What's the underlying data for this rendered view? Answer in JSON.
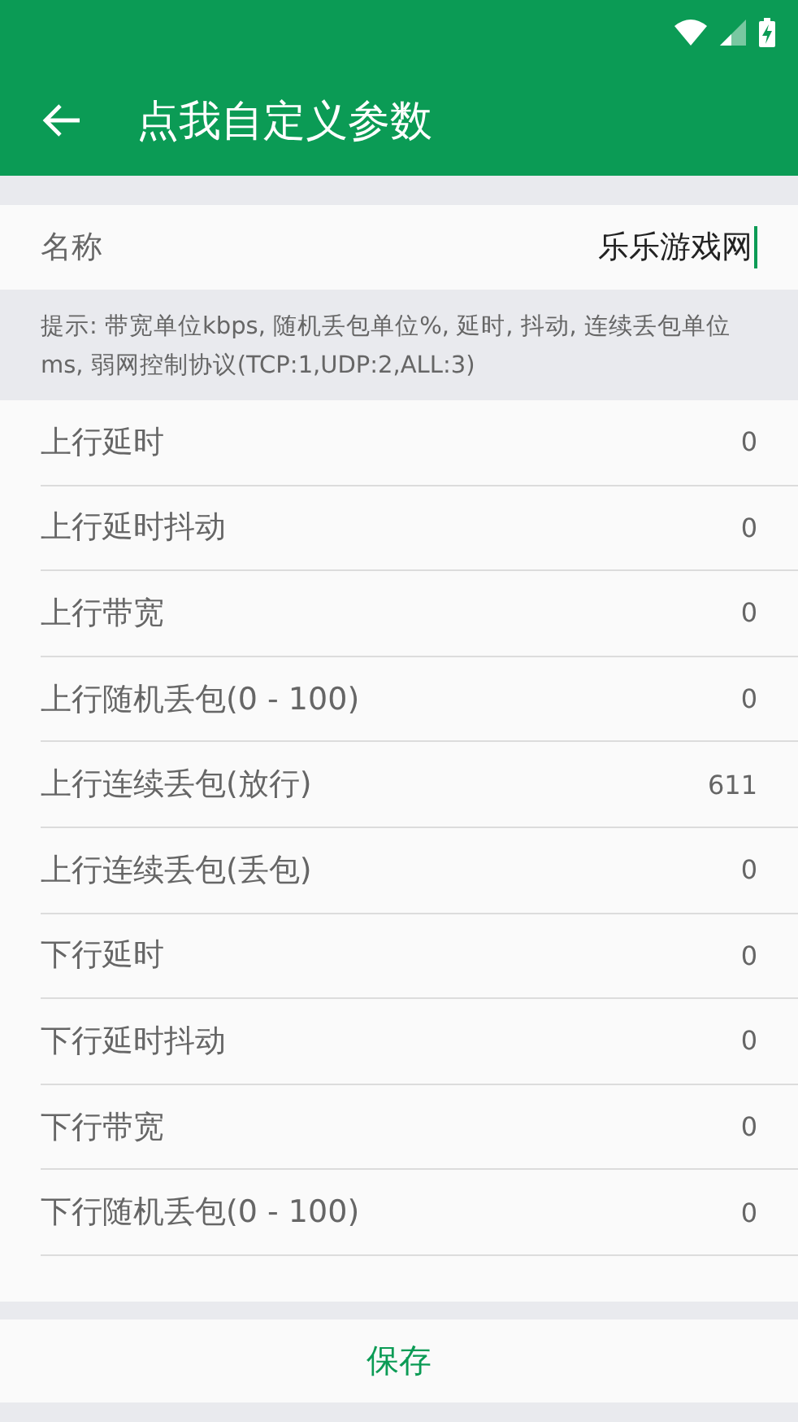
{
  "toolbar": {
    "title": "点我自定义参数"
  },
  "name_field": {
    "label": "名称",
    "value": "乐乐游戏网"
  },
  "hint": "提示: 带宽单位kbps, 随机丢包单位%, 延时, 抖动, 连续丢包单位ms, 弱网控制协议(TCP:1,UDP:2,ALL:3)",
  "params": [
    {
      "label": "上行延时",
      "value": "0"
    },
    {
      "label": "上行延时抖动",
      "value": "0"
    },
    {
      "label": "上行带宽",
      "value": "0"
    },
    {
      "label": "上行随机丢包(0 - 100)",
      "value": "0"
    },
    {
      "label": "上行连续丢包(放行)",
      "value": "611"
    },
    {
      "label": "上行连续丢包(丢包)",
      "value": "0"
    },
    {
      "label": "下行延时",
      "value": "0"
    },
    {
      "label": "下行延时抖动",
      "value": "0"
    },
    {
      "label": "下行带宽",
      "value": "0"
    },
    {
      "label": "下行随机丢包(0 - 100)",
      "value": "0"
    }
  ],
  "save_button": "保存"
}
